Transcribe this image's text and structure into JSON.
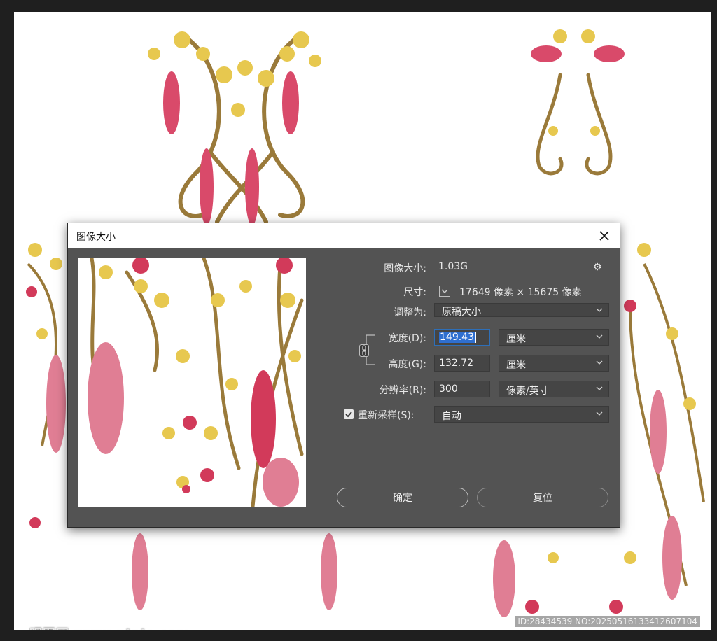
{
  "dialog": {
    "title": "图像大小",
    "image_size_label": "图像大小:",
    "image_size_value": "1.03G",
    "dimensions_label": "尺寸:",
    "dimensions_value": "17649 像素 × 15675 像素",
    "fit_to_label": "调整为:",
    "fit_to_value": "原稿大小",
    "width_label": "宽度(D):",
    "width_value": "149.43",
    "width_unit": "厘米",
    "height_label": "高度(G):",
    "height_value": "132.72",
    "height_unit": "厘米",
    "resolution_label": "分辨率(R):",
    "resolution_value": "300",
    "resolution_unit": "像素/英寸",
    "resample_label": "重新采样(S):",
    "resample_value": "自动",
    "resample_checked": true,
    "ok_label": "确定",
    "reset_label": "复位"
  },
  "watermark": {
    "left": "昵图网 www.nipic.com",
    "right": "ID:28434539 NO:20250516133412607104"
  }
}
